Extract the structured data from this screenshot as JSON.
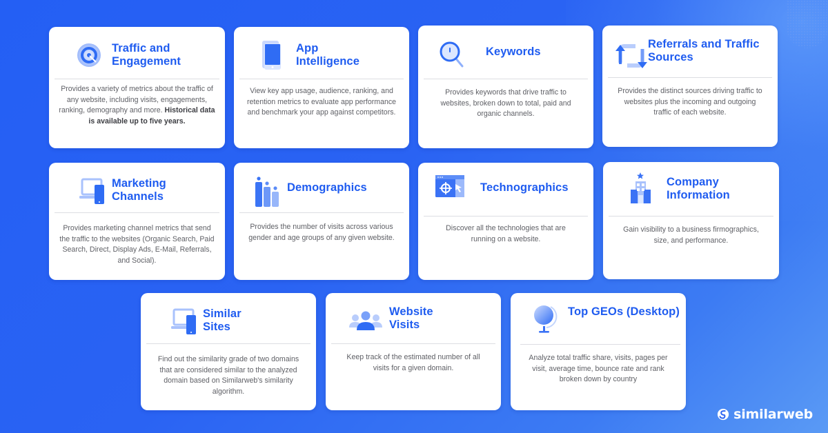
{
  "theme": {
    "background": "#2560f4",
    "accent": "#1f5cf0",
    "card_bg": "#ffffff",
    "text": "#5f6066"
  },
  "cards": [
    {
      "id": "traffic-engagement",
      "icon": "target-icon",
      "title": "Traffic and\nEngagement",
      "description": "Provides a variety of metrics about the traffic of any website, including visits, engagements, ranking, demography and more.",
      "description_bold": "Historical data is available up to five years."
    },
    {
      "id": "app-intelligence",
      "icon": "smartphone-icon",
      "title": "App\nIntelligence",
      "description": "View key app usage, audience, ranking, and retention metrics to evaluate app performance and benchmark your app against competitors."
    },
    {
      "id": "keywords",
      "icon": "magnifier-icon",
      "title": "Keywords",
      "description": "Provides keywords that drive traffic to websites, broken down to total, paid and organic channels."
    },
    {
      "id": "referrals",
      "icon": "refresh-arrows-icon",
      "title": "Referrals and Traffic\nSources",
      "description": "Provides the distinct sources driving traffic to websites plus the incoming and outgoing traffic of each website."
    },
    {
      "id": "marketing-channels",
      "icon": "devices-icon",
      "title": "Marketing\nChannels",
      "description": "Provides marketing channel metrics that send the traffic to the websites (Organic Search, Paid Search, Direct, Display Ads, E-Mail, Referrals, and Social)."
    },
    {
      "id": "demographics",
      "icon": "people-bars-icon",
      "title": "Demographics",
      "description": "Provides the number of visits across various gender and age groups of any given website."
    },
    {
      "id": "technographics",
      "icon": "browser-crosshair-icon",
      "title": "Technographics",
      "description": "Discover all the technologies that are running on a website."
    },
    {
      "id": "company-information",
      "icon": "building-icon",
      "title": "Company\nInformation",
      "description": "Gain visibility to a business firmographics, size, and performance."
    },
    {
      "id": "similar-sites",
      "icon": "devices-icon",
      "title": "Similar\nSites",
      "description": "Find out the similarity grade of two domains that are considered similar to the analyzed domain based on Similarweb's similarity algorithm."
    },
    {
      "id": "website-visits",
      "icon": "users-group-icon",
      "title": "Website\nVisits",
      "description": "Keep track of the estimated number of all visits for a given domain."
    },
    {
      "id": "top-geos",
      "icon": "globe-icon",
      "title": "Top GEOs (Desktop)",
      "description": "Analyze total traffic share, visits, pages per visit, average time, bounce rate and rank broken down by country"
    }
  ],
  "brand": {
    "name": "similarweb",
    "icon": "similarweb-logo-icon"
  }
}
